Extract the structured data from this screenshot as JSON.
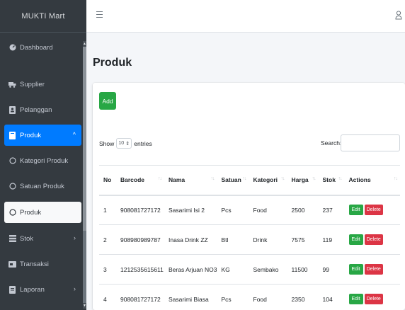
{
  "app": {
    "brand": "MUKTI Mart"
  },
  "sidebar": {
    "items": [
      {
        "label": "Dashboard",
        "icon": "dashboard-icon"
      },
      {
        "label": "Supplier",
        "icon": "truck-icon"
      },
      {
        "label": "Pelanggan",
        "icon": "address-book-icon"
      },
      {
        "label": "Produk",
        "icon": "product-box-icon",
        "active": true
      },
      {
        "label": "Kategori Produk",
        "icon": "circle-icon"
      },
      {
        "label": "Satuan Produk",
        "icon": "circle-icon"
      },
      {
        "label": "Produk",
        "icon": "circle-icon",
        "current": true
      },
      {
        "label": "Stok",
        "icon": "stock-icon"
      },
      {
        "label": "Transaksi",
        "icon": "transaction-icon"
      },
      {
        "label": "Laporan",
        "icon": "report-icon"
      }
    ]
  },
  "page": {
    "title": "Produk"
  },
  "toolbar": {
    "add_label": "Add"
  },
  "datatable": {
    "show_label": "Show",
    "entries_value": "10",
    "entries_label": "entries",
    "search_label": "Search:"
  },
  "table": {
    "columns": [
      "No",
      "Barcode",
      "Nama",
      "Satuan",
      "Kategori",
      "Harga",
      "Stok",
      "Actions"
    ],
    "rows": [
      {
        "no": "1",
        "barcode": "908081727172",
        "nama": "Sasarimi Isi 2",
        "satuan": "Pcs",
        "kategori": "Food",
        "harga": "2500",
        "stok": "237"
      },
      {
        "no": "2",
        "barcode": "908980989787",
        "nama": "Inasa Drink ZZ",
        "satuan": "Btl",
        "kategori": "Drink",
        "harga": "7575",
        "stok": "119"
      },
      {
        "no": "3",
        "barcode": "1212535615611",
        "nama": "Beras Arjuan NO3",
        "satuan": "KG",
        "kategori": "Sembako",
        "harga": "11500",
        "stok": "99"
      },
      {
        "no": "4",
        "barcode": "908081727172",
        "nama": "Sasarimi Biasa",
        "satuan": "Pcs",
        "kategori": "Food",
        "harga": "2350",
        "stok": "104"
      }
    ],
    "edit_label": "Edit",
    "delete_label": "Delete"
  },
  "colors": {
    "sidebar_bg": "#343a40",
    "active": "#007bff",
    "success": "#28a745",
    "danger": "#dc3545"
  }
}
